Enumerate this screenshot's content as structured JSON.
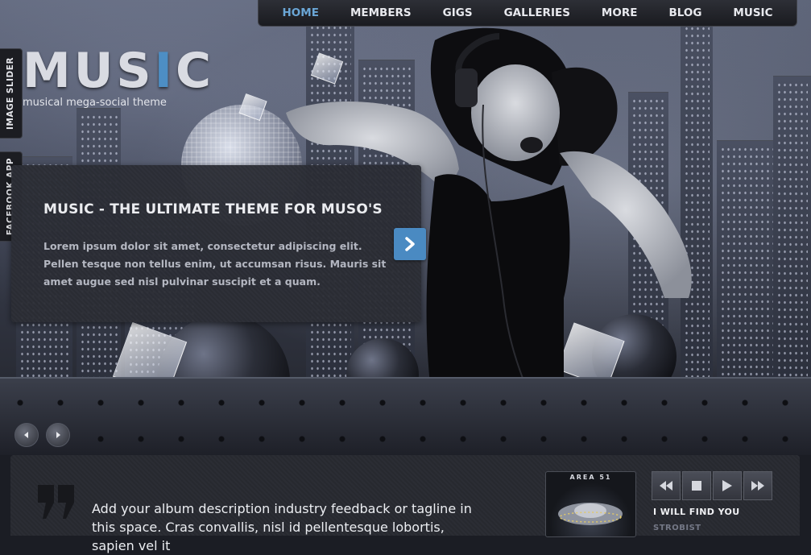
{
  "nav": {
    "items": [
      {
        "label": "HOME",
        "active": true
      },
      {
        "label": "MEMBERS",
        "active": false
      },
      {
        "label": "GIGS",
        "active": false
      },
      {
        "label": "GALLERIES",
        "active": false
      },
      {
        "label": "MORE",
        "active": false
      },
      {
        "label": "BLOG",
        "active": false
      },
      {
        "label": "MUSIC",
        "active": false
      }
    ]
  },
  "logo": {
    "text_before": "MUS",
    "text_accent": "I",
    "text_after": "C",
    "tagline": "musical mega-social theme"
  },
  "side_tabs": {
    "image_slider": "IMAGE SLIDER",
    "facebook_app": "FACEBOOK APP"
  },
  "slide": {
    "title": "MUSIC - THE ULTIMATE THEME FOR MUSO'S",
    "body": "Lorem ipsum dolor sit amet, consectetur adipiscing elit. Pellen tesque non tellus enim, ut accumsan risus. Mauris sit amet augue sed nisl pulvinar suscipit et a quam."
  },
  "album": {
    "description": "Add your album description industry feedback or tagline in this space. Cras convallis, nisl id pellentesque lobortis, sapien vel it",
    "art_label": "AREA 51"
  },
  "player": {
    "track_title": "I WILL FIND YOU",
    "artist": "STROBIST"
  },
  "colors": {
    "accent": "#4a8ac2",
    "nav_active": "#6aa6d6",
    "panel": "#2b2d34"
  }
}
